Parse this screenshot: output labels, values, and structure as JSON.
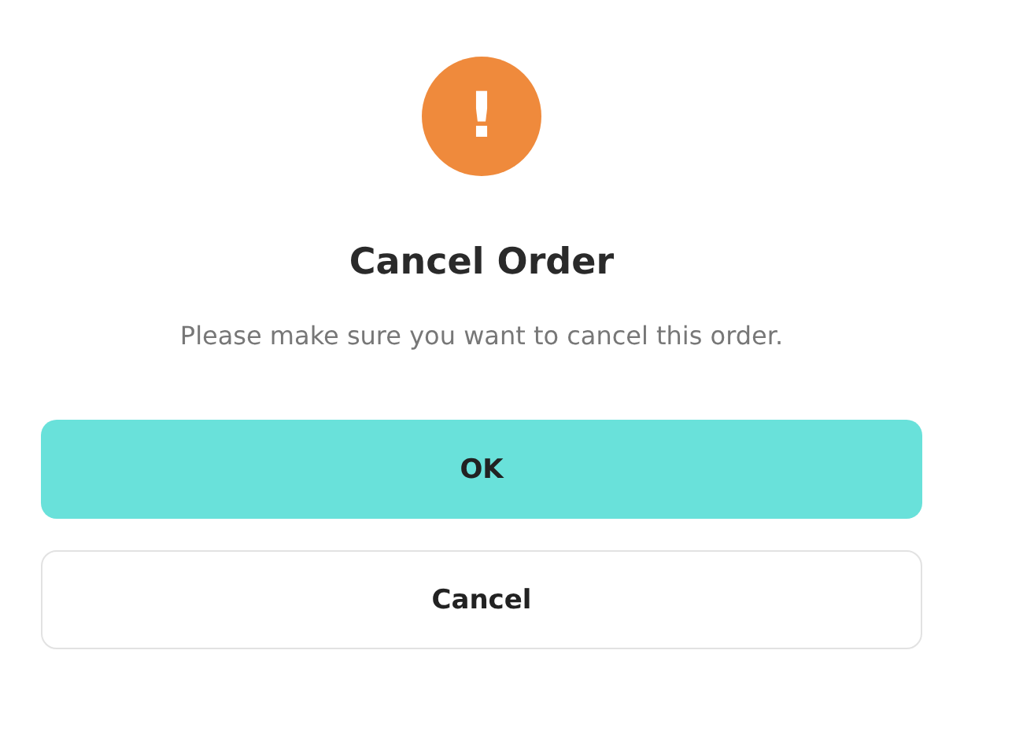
{
  "dialog": {
    "icon": "!",
    "title": "Cancel Order",
    "message": "Please make sure you want to cancel this order.",
    "buttons": [
      {
        "label": "OK",
        "kind": "primary"
      },
      {
        "label": "Cancel",
        "kind": "secondary"
      }
    ]
  }
}
